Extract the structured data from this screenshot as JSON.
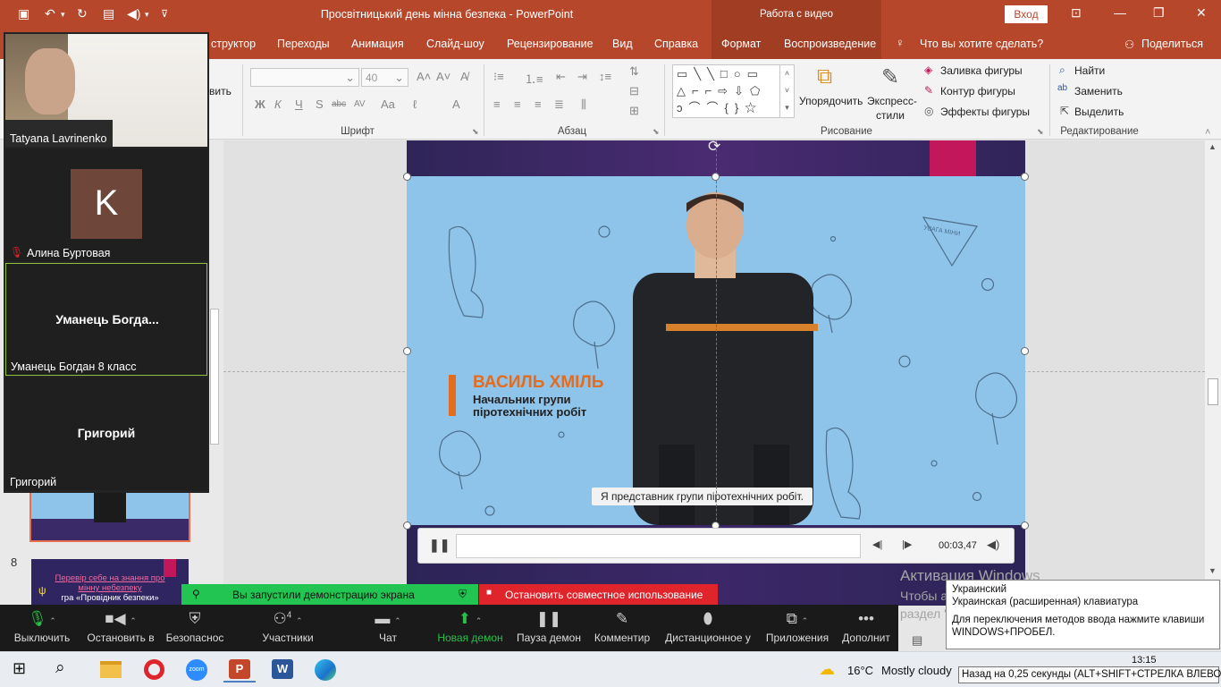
{
  "titlebar": {
    "title": "Просвітницький день мінна безпека  -  PowerPoint",
    "video_tools": "Работа с видео",
    "signin": "Вход",
    "qa_icons": [
      "save-icon",
      "undo-icon",
      "redo-icon",
      "present-icon",
      "audio-icon",
      "customize-icon"
    ]
  },
  "tabs": {
    "items": [
      "структор",
      "Переходы",
      "Анимация",
      "Слайд-шоу",
      "Рецензирование",
      "Вид",
      "Справка",
      "Формат",
      "Воспроизведение"
    ],
    "search": "Что вы хотите сделать?",
    "share": "Поделиться"
  },
  "ribbon": {
    "clipboard_partial": "вить",
    "font_name": "",
    "font_size": "40",
    "font_group": "Шрифт",
    "paragraph_group": "Абзац",
    "drawing_group": "Рисование",
    "arrange": "Упорядочить",
    "quick_styles_1": "Экспресс-",
    "quick_styles_2": "стили",
    "shape_fill": "Заливка фигуры",
    "shape_outline": "Контур фигуры",
    "shape_effects": "Эффекты фигуры",
    "find": "Найти",
    "replace": "Заменить",
    "select": "Выделить",
    "editing_group": "Редактирование",
    "bold": "Ж",
    "italic": "К",
    "underline": "Ч",
    "shadow": "S",
    "strike": "abc",
    "spacing": "AV",
    "case": "Aa",
    "fontcolor": "A"
  },
  "slides": {
    "current_number": "8",
    "thumb8_line1": "Перевір себе на знання про",
    "thumb8_line2": "мінну небезпеку",
    "thumb8_line3": "гра «Провідник безпеки»"
  },
  "video": {
    "name": "ВАСИЛЬ ХМІЛЬ",
    "role_line1": "Начальник групи",
    "role_line2": "піротехнічних робіт",
    "subtitle": "Я представник групи піротехнічних робіт.",
    "sign_text": "УВАГА МІНИ",
    "time": "00:03,47",
    "progress": 0.0
  },
  "zoom": {
    "participants": [
      {
        "name": "Tatyana Lavrinenko",
        "has_video": true
      },
      {
        "name": "Алина Буртовая",
        "initial": "K",
        "muted": true
      },
      {
        "name": "Уманець Богдан 8 класс",
        "big": "Уманець  Богда..."
      },
      {
        "name": "Григорий",
        "big": "Григорий"
      }
    ],
    "share_started": "Вы запустили демонстрацию экрана",
    "stop_share": "Остановить совместное использование",
    "toolbar": [
      {
        "label": "Выключить",
        "icon": "mic-icon"
      },
      {
        "label": "Остановить в",
        "icon": "video-camera-icon"
      },
      {
        "label": "Безопаснос",
        "icon": "security-shield-icon"
      },
      {
        "label": "Участники",
        "icon": "participants-icon",
        "count": "4"
      },
      {
        "label": "Чат",
        "icon": "chat-icon"
      },
      {
        "label": "Новая демон",
        "icon": "share-screen-icon"
      },
      {
        "label": "Пауза демон",
        "icon": "pause-share-icon"
      },
      {
        "label": "Комментир",
        "icon": "annotate-icon"
      },
      {
        "label": "Дистанционное у",
        "icon": "remote-control-icon"
      },
      {
        "label": "Приложения",
        "icon": "apps-icon"
      },
      {
        "label": "Дополнит",
        "icon": "more-icon"
      }
    ]
  },
  "windows": {
    "activation_title": "Активация Windows",
    "activation_line1": "Чтобы активировать Windows, перейдите в",
    "activation_line2": "раздел \"Параметры\".",
    "ime_line1": "Украинский",
    "ime_line2": "Украинская (расширенная) клавиатура",
    "ime_line3": "Для переключения методов ввода нажмите клавиши",
    "ime_line4": "WINDOWS+ПРОБЕЛ.",
    "weather_temp": "16°C",
    "weather_text": "Mostly cloudy",
    "clock": "13:15",
    "tooltip": "Назад на 0,25 секунды (ALT+SHIFT+СТРЕЛКА ВЛЕВО)"
  },
  "colors": {
    "ppt_red": "#b7472a",
    "zoom_green": "#23c552",
    "zoom_red": "#e0242b",
    "name_orange": "#e46c1e"
  }
}
